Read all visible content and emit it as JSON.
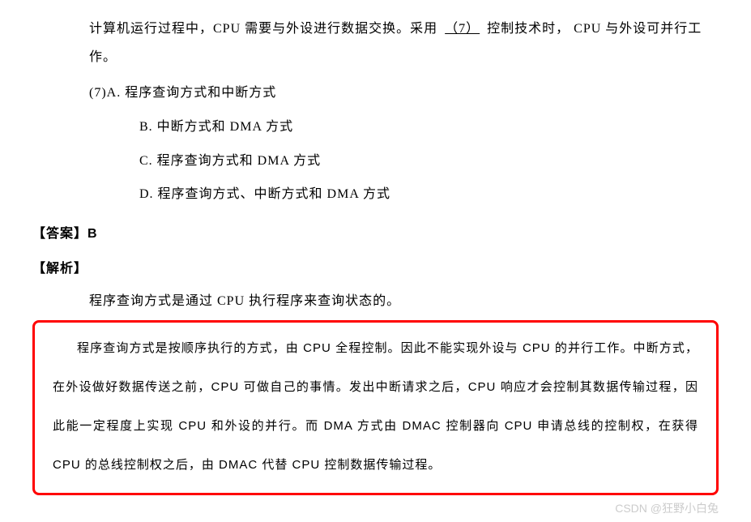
{
  "question": {
    "intro_part1": "计算机运行过程中，CPU 需要与外设进行数据交换。采用",
    "blank": "（7）",
    "intro_part2": "控制技术时， CPU 与外设可并行工作。",
    "option_a": "(7)A. 程序查询方式和中断方式",
    "option_b": "B. 中断方式和 DMA 方式",
    "option_c": "C. 程序查询方式和 DMA 方式",
    "option_d": "D. 程序查询方式、中断方式和 DMA 方式"
  },
  "answer": {
    "label": "【答案】B"
  },
  "explanation": {
    "label": "【解析】",
    "line1": "程序查询方式是通过 CPU 执行程序来查询状态的。",
    "highlight": "程序查询方式是按顺序执行的方式，由 CPU 全程控制。因此不能实现外设与 CPU 的并行工作。中断方式，在外设做好数据传送之前，CPU 可做自己的事情。发出中断请求之后，CPU 响应才会控制其数据传输过程，因此能一定程度上实现 CPU 和外设的并行。而 DMA 方式由 DMAC 控制器向 CPU 申请总线的控制权，在获得 CPU 的总线控制权之后，由 DMAC 代替 CPU 控制数据传输过程。"
  },
  "watermark": "CSDN @狂野小白兔"
}
